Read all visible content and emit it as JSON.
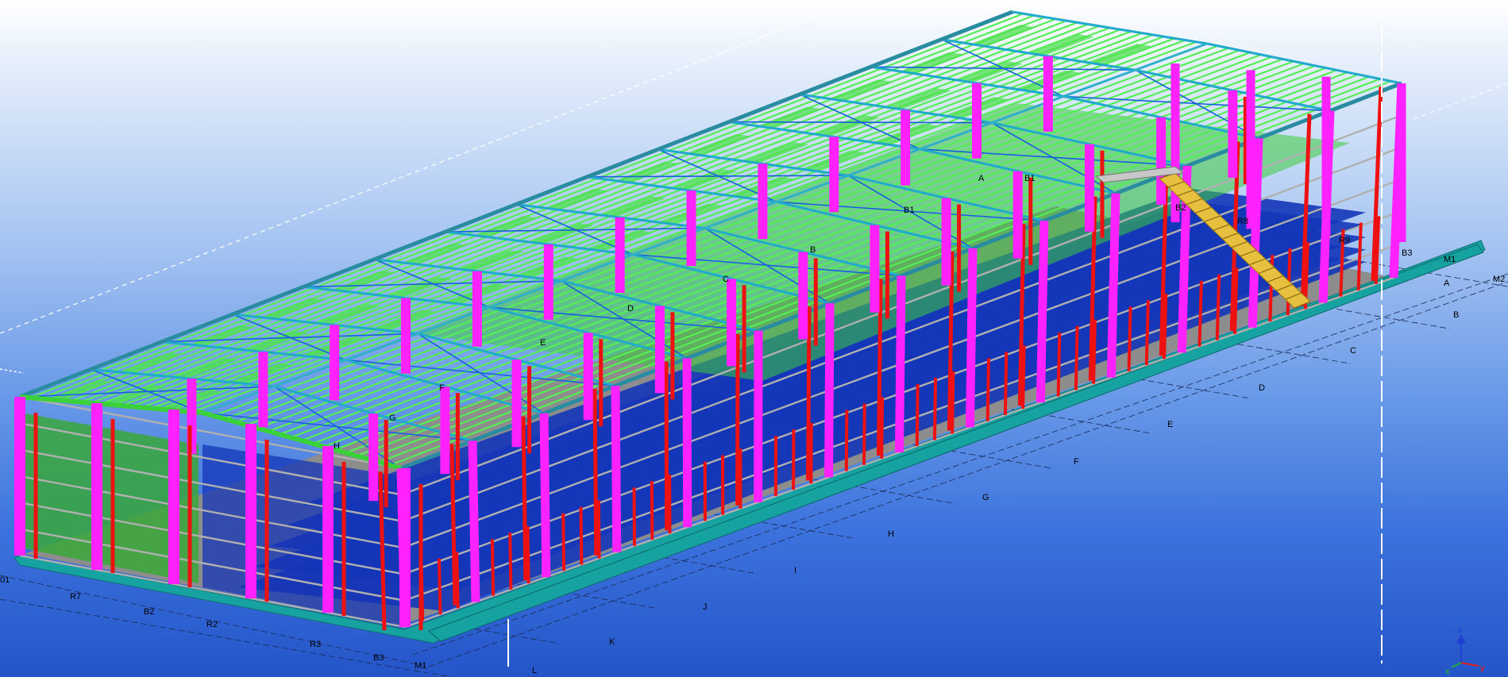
{
  "viewport": {
    "background_top": "#ffffff",
    "background_bottom": "#2455c9"
  },
  "colors": {
    "column_primary": "#ff22ff",
    "column_secondary": "#ee1111",
    "rafter": "#22aacc",
    "purlin": "#55ee55",
    "bracing": "#1a5fe0",
    "girt": "#b0b0b0",
    "slab": "#16a2a0",
    "floor_panel": "#1436b8",
    "stair": "#e8c040",
    "grid_line": "#1a2a55"
  },
  "grid_labels": {
    "long_axis": [
      "A",
      "B",
      "C",
      "D",
      "E",
      "F",
      "G",
      "H",
      "I",
      "J",
      "K",
      "L"
    ],
    "cross_axis": [
      "M1",
      "M2",
      "R7",
      "B2",
      "R2",
      "R3",
      "B3",
      "M1",
      "B1",
      "R8",
      "R9",
      "B2",
      "B3"
    ],
    "frame_axis": [
      "01"
    ],
    "interior": [
      "A",
      "B1",
      "B",
      "C",
      "D",
      "E",
      "F",
      "G",
      "H"
    ]
  },
  "axis_indicator": {
    "z": "z",
    "x": "x",
    "y": "y"
  }
}
